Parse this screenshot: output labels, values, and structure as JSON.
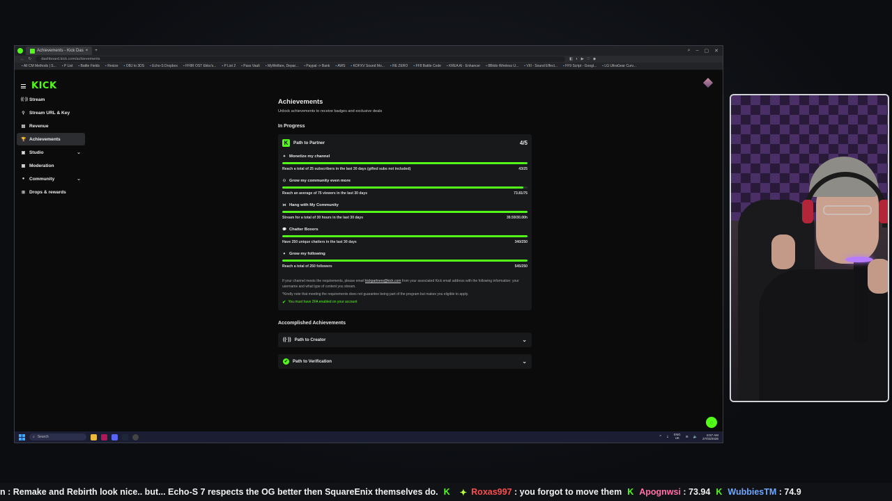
{
  "browser": {
    "tab_title": "Achievements - Kick Das",
    "url": "dashboard.kick.com/achievements",
    "bookmarks": [
      "All CM Methods | S...",
      "P List",
      "Battle Fields",
      "Resize",
      "OBJ to 3DS",
      "Echo-S Dropbox",
      "FF8R OST Ekko's...",
      "P List 2",
      "Pass Vault",
      "MyWelfare, Depar...",
      "Paypal -> Bank",
      "AWS",
      "KOFXV Sound Mo...",
      "RE ZERO",
      "FF8 Battle Code",
      "KREA AI - Enhancer",
      "8Bitdo Wireless U...",
      "VIII - Sound Effect...",
      "FF9 Script - Googl...",
      "LG UltraGear Curv..."
    ]
  },
  "sidebar": {
    "logo": "KICK",
    "items": [
      {
        "label": "Stream",
        "icon": "((·))"
      },
      {
        "label": "Stream URL & Key",
        "icon": "⚲"
      },
      {
        "label": "Revenue",
        "icon": "▤"
      },
      {
        "label": "Achievements",
        "icon": "🏆"
      },
      {
        "label": "Studio",
        "icon": "▣"
      },
      {
        "label": "Moderation",
        "icon": "▦"
      },
      {
        "label": "Community",
        "icon": "●"
      },
      {
        "label": "Drops & rewards",
        "icon": "⊞"
      }
    ]
  },
  "main": {
    "title": "Achievements",
    "subtitle": "Unlock achievements to receive badges and exclusive deals",
    "in_progress_heading": "In Progress",
    "partner": {
      "name": "Path to Partner",
      "score": "4/5",
      "requirements": [
        {
          "title": "Monetize my channel",
          "icon": "✦",
          "desc": "Reach a total of 25 subscribers in the last 30 days (gifted subs not included)",
          "value": "43/25",
          "progress": 1.0
        },
        {
          "title": "Grow my community even more",
          "icon": "⚇",
          "desc": "Reach an average of 75 viewers in the last 30 days",
          "value": "73.81/75",
          "progress": 0.984
        },
        {
          "title": "Hang with My Community",
          "icon": "⋈",
          "desc": "Stream for a total of 30 hours in the last 30 days",
          "value": "39.59/30.00h",
          "progress": 1.0
        },
        {
          "title": "Chatter Boxers",
          "icon": "💬",
          "desc": "Have 250 unique chatters in the last 30 days",
          "value": "340/250",
          "progress": 1.0
        },
        {
          "title": "Grow my following",
          "icon": "♥",
          "desc": "Reach a total of 250 followers",
          "value": "545/250",
          "progress": 1.0
        }
      ],
      "info_prefix": "If your channel meets the requirements, please email ",
      "info_email": "kickpartners@kick.com",
      "info_suffix": " from your associated Kick email address with the following information: your username and what type of content you stream.",
      "note": "*Kindly note that meeting the requirements does not guarantee being part of the program but makes you eligible to apply.",
      "twofa": "You must have 2FA enabled on your account"
    },
    "accomplished_heading": "Accomplished Achievements",
    "accomplished": [
      {
        "name": "Path to Creator"
      },
      {
        "name": "Path to Verification"
      }
    ]
  },
  "taskbar": {
    "search_placeholder": "Search",
    "lang_top": "ENG",
    "lang_bottom": "UK",
    "time": "8:57 AM",
    "date": "27/03/2026"
  },
  "ticker": {
    "msg1": "n : Remake and Rebirth look nice.. but... Echo-S 7 respects the OG better then SquareEnix themselves do.",
    "user2": "Roxas997",
    "msg2": ": you forgot to move them",
    "user3": "Apognwsi",
    "msg3": ": 73.94",
    "user4": "WubbiesTM",
    "msg4": ": 74.9"
  },
  "colors": {
    "kick_green": "#53fc18",
    "background": "#0b0b0c",
    "card": "#18191b"
  }
}
